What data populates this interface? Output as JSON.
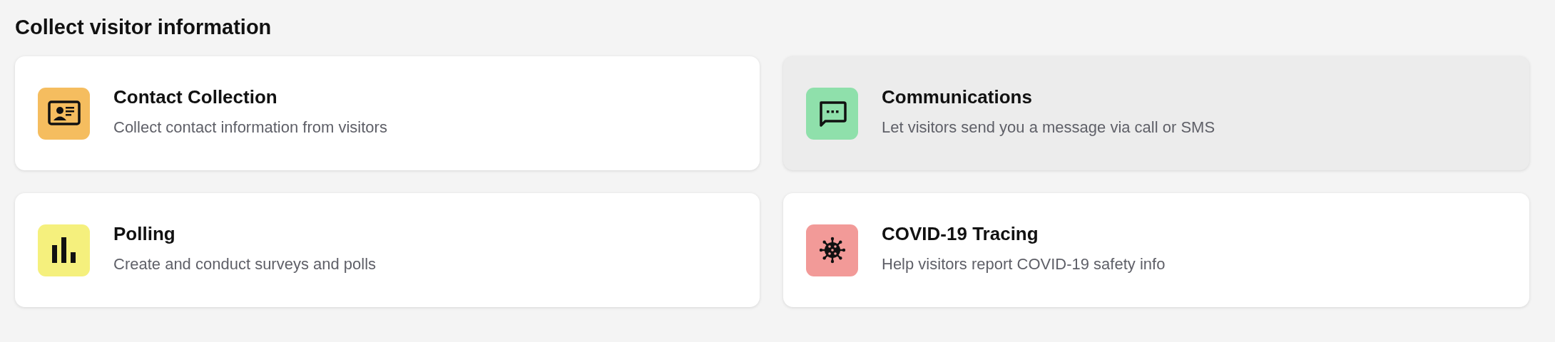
{
  "section": {
    "title": "Collect visitor information"
  },
  "cards": [
    {
      "kind": "contact",
      "title": "Contact Collection",
      "description": "Collect contact information from visitors",
      "color": "#f5bd5f",
      "highlighted": false
    },
    {
      "kind": "chat",
      "title": "Communications",
      "description": "Let visitors send you a message via call or SMS",
      "color": "#8fe0ab",
      "highlighted": true
    },
    {
      "kind": "poll",
      "title": "Polling",
      "description": "Create and conduct surveys and polls",
      "color": "#f5f07d",
      "highlighted": false
    },
    {
      "kind": "virus",
      "title": "COVID-19 Tracing",
      "description": "Help visitors report COVID-19 safety info",
      "color": "#f29a98",
      "highlighted": false
    }
  ]
}
